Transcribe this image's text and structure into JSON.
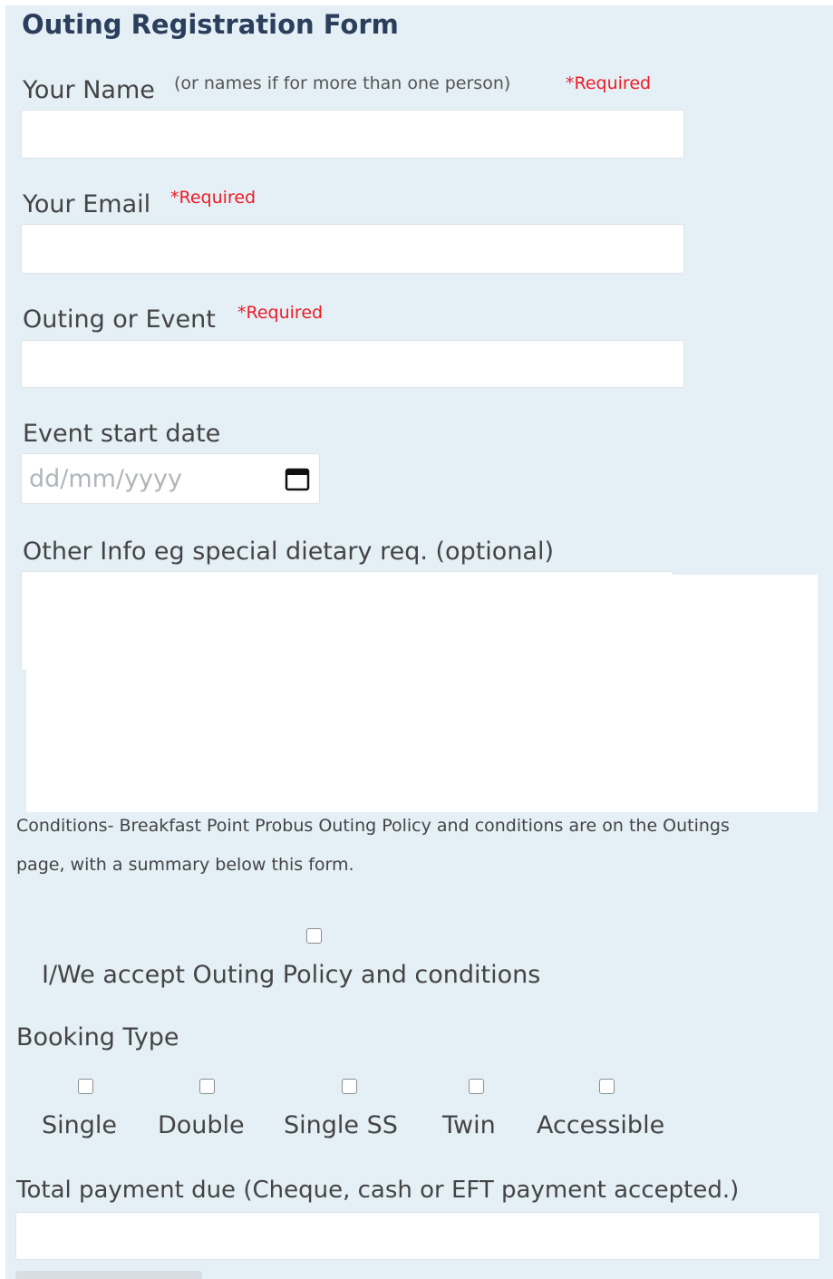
{
  "form": {
    "title": "Outing Registration Form",
    "name": {
      "label": "Your Name",
      "note": "(or names if for more than one person)",
      "required": "*Required",
      "value": ""
    },
    "email": {
      "label": "Your Email",
      "required": "*Required",
      "value": ""
    },
    "outing": {
      "label": "Outing or Event",
      "required": "*Required",
      "value": ""
    },
    "start_date": {
      "label": "Event start date",
      "placeholder": "dd/mm/yyyy"
    },
    "other_info": {
      "label": "Other Info eg special dietary req. (optional)",
      "value": ""
    },
    "conditions": {
      "line1": "Conditions- Breakfast Point Probus Outing Policy and conditions are on the Outings",
      "line2": "page, with a summary below this form."
    },
    "accept": {
      "label": "I/We accept Outing Policy and conditions",
      "checked": false
    },
    "booking_type": {
      "label": "Booking Type",
      "options": [
        {
          "label": "Single",
          "checked": false
        },
        {
          "label": "Double",
          "checked": false
        },
        {
          "label": "Single SS",
          "checked": false
        },
        {
          "label": "Twin",
          "checked": false
        },
        {
          "label": "Accessible",
          "checked": false
        }
      ]
    },
    "payment": {
      "label": "Total payment due (Cheque, cash or EFT payment accepted.)",
      "value": ""
    }
  },
  "colors": {
    "panel_bg": "#e4eff6",
    "title": "#2b3f5c",
    "required": "#ee1c25",
    "text": "#444444"
  }
}
